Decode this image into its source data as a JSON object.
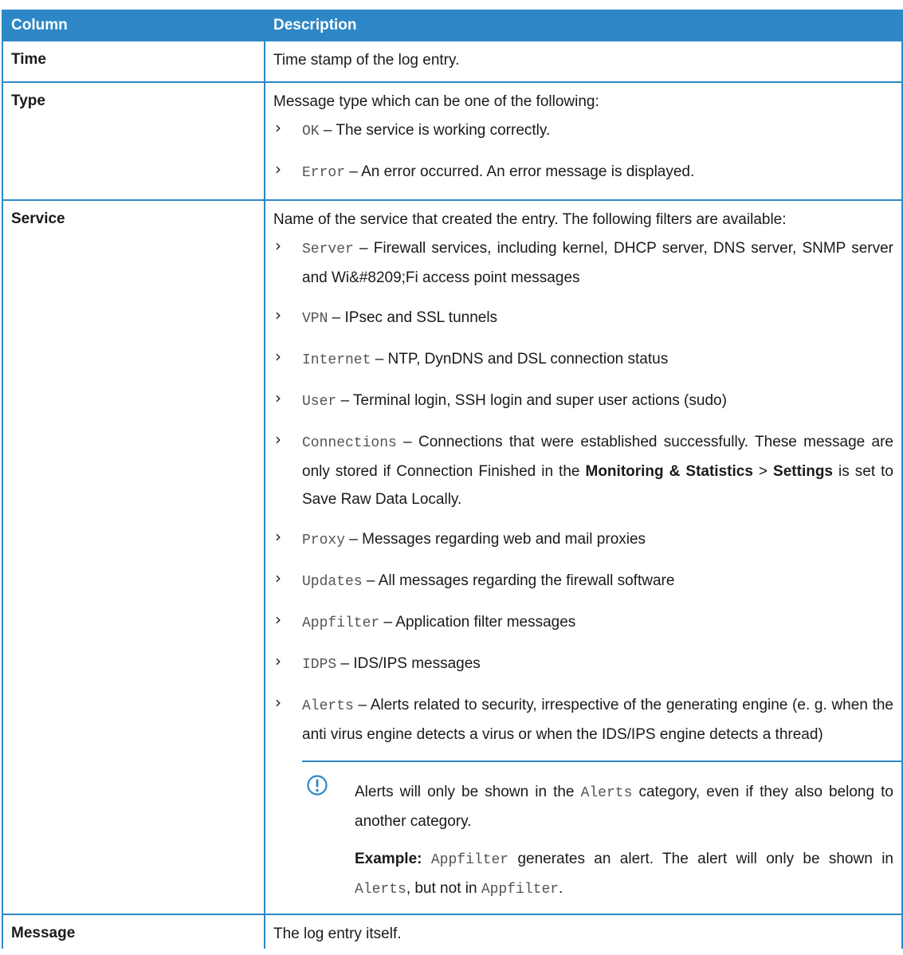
{
  "colors": {
    "accent": "#2d87c6",
    "header_text": "#ffffff"
  },
  "table": {
    "headers": [
      "Column",
      "Description"
    ],
    "rows": {
      "time": {
        "column": "Time",
        "description": "Time stamp of the log entry."
      },
      "type": {
        "column": "Type",
        "intro": "Message type which can be one of the following:",
        "items": [
          {
            "code": "OK",
            "text": " – The service is working correctly."
          },
          {
            "code": "Error",
            "text": " – An error occurred. An error message is displayed."
          }
        ]
      },
      "service": {
        "column": "Service",
        "intro": "Name of the service that created the entry. The following filters are available:",
        "items": [
          {
            "code": "Server",
            "text": " – Firewall services, including kernel, DHCP server, DNS server, SNMP server and Wi&#8209;Fi access point messages"
          },
          {
            "code": "VPN",
            "text": " – IPsec and SSL tunnels"
          },
          {
            "code": "Internet",
            "text": " – NTP, DynDNS and DSL connection status"
          },
          {
            "code": "User",
            "text": " – Terminal login, SSH login and super user actions (sudo)"
          },
          {
            "code": "Connections",
            "text_a": " – Connections that were established successfully. These message are only stored if Connection Finished in the ",
            "bold_a": "Monitoring & Statistics",
            "sep": " > ",
            "bold_b": "Settings",
            "text_b": " is set to Save Raw Data Locally."
          },
          {
            "code": "Proxy",
            "text": " – Messages regarding web and mail proxies"
          },
          {
            "code": "Updates",
            "text": " – All messages regarding the firewall software"
          },
          {
            "code": "Appfilter",
            "text": " – Application filter messages"
          },
          {
            "code": "IDPS",
            "text": " – IDS/IPS messages"
          },
          {
            "code": "Alerts",
            "text": " – Alerts related to security, irrespective of the generating engine (e. g. when the anti virus engine detects a virus or when the IDS/IPS engine detects a thread)"
          }
        ],
        "note": {
          "icon": "info-exclamation-icon",
          "p1_a": "Alerts will only be shown in the ",
          "p1_code": "Alerts",
          "p1_b": " category, even if they also belong to another category.",
          "p2_label": "Example:",
          "p2_code1": "Appfilter",
          "p2_a": " generates an alert. The alert will only be shown in ",
          "p2_code2": "Alerts",
          "p2_b": ", but not in ",
          "p2_code3": "Appfilter",
          "p2_c": "."
        }
      },
      "message": {
        "column": "Message",
        "description": "The log entry itself."
      }
    }
  }
}
